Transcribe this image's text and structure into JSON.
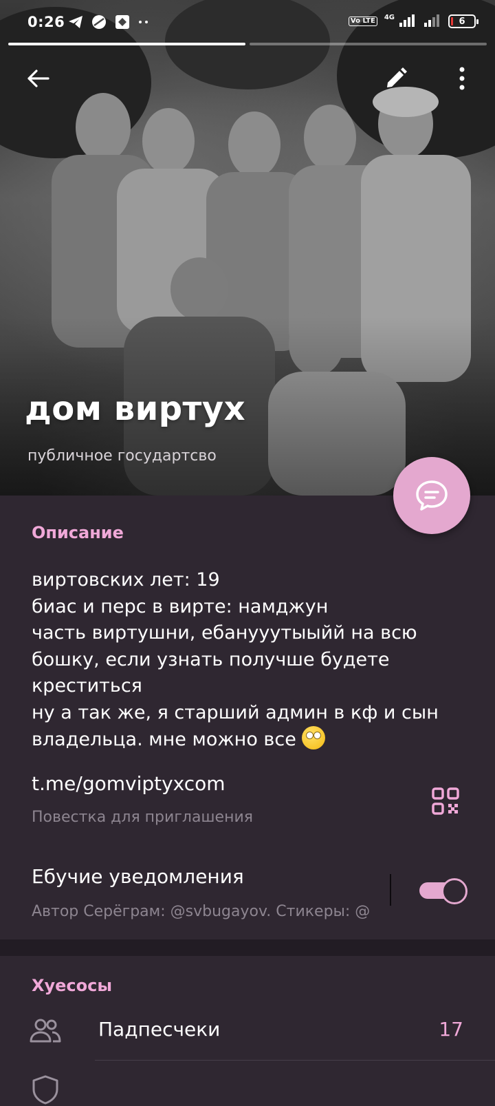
{
  "status_bar": {
    "time": "0:26",
    "volte": "Vo LTE",
    "network": "4G",
    "battery": "6"
  },
  "header": {
    "title": "дом виртух",
    "subtitle": "публичное государтсво"
  },
  "description": {
    "label": "Описание",
    "text": "виртовских лет: 19\nбиас и перс в вирте: намджун\nчасть виртушни, ебанууутыыйй на всю бошку, если узнать получше будете креститься\nну а так же, я старший админ в кф и сын владельца. мне можно все"
  },
  "invite": {
    "link": "t.me/gomviptyxcom",
    "caption": "Повестка для приглашения"
  },
  "notifications": {
    "title": "Ебучие уведомления",
    "subtitle": "Автор Серёграм: @svbugayov. Стикеры: @",
    "enabled": true
  },
  "members": {
    "label": "Хуесосы",
    "items": [
      {
        "label": "Падпесчеки",
        "count": "17"
      }
    ]
  },
  "colors": {
    "accent": "#f0a8d8",
    "fab": "#e4a8cf",
    "background": "#2f2731",
    "section_gap": "#221c24"
  }
}
